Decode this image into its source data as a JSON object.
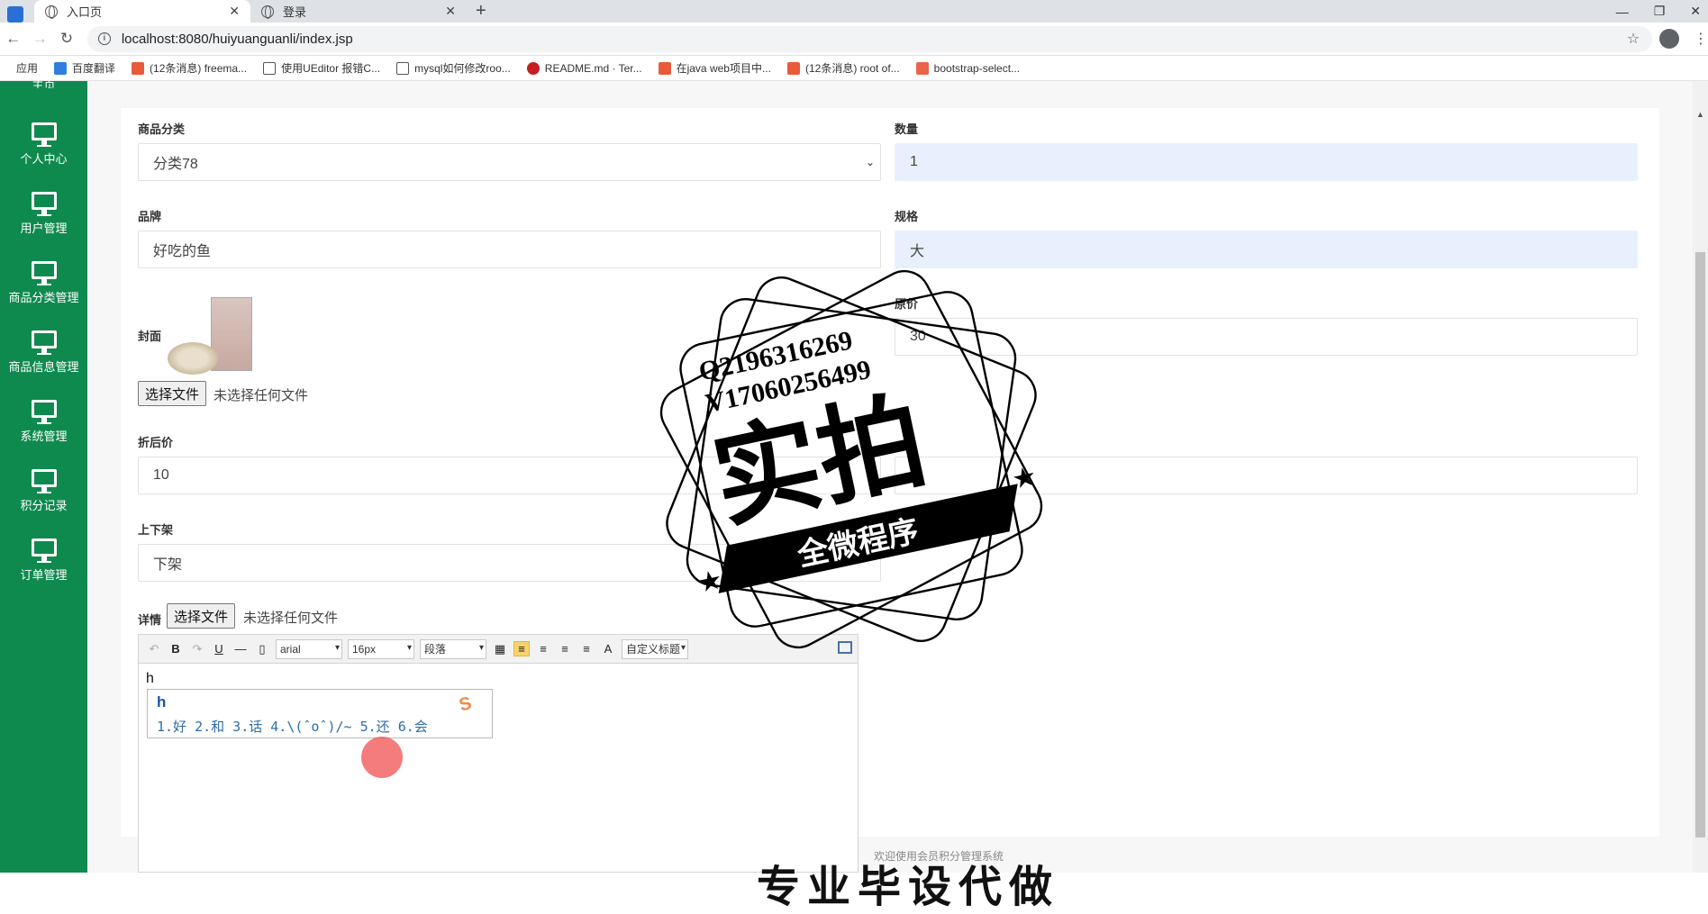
{
  "browser": {
    "tabs": [
      {
        "label": "入口页",
        "active": true
      },
      {
        "label": "登录",
        "active": false
      }
    ],
    "url": "localhost:8080/huiyuanguanli/index.jsp",
    "bookmarks": [
      "应用",
      "百度翻译",
      "(12条消息) freema...",
      "使用UEditor 报错C...",
      "mysql如何修改roo...",
      "README.md · Ter...",
      "在java web项目中...",
      "(12条消息) root of...",
      "bootstrap-select..."
    ]
  },
  "sidebar": {
    "top_partial": "主页",
    "items": [
      {
        "label": "个人中心",
        "icon": "monitor-icon"
      },
      {
        "label": "用户管理",
        "icon": "monitor-icon"
      },
      {
        "label": "商品分类管理",
        "icon": "monitor-icon"
      },
      {
        "label": "商品信息管理",
        "icon": "monitor-icon"
      },
      {
        "label": "系统管理",
        "icon": "monitor-icon"
      },
      {
        "label": "积分记录",
        "icon": "monitor-icon"
      },
      {
        "label": "订单管理",
        "icon": "monitor-icon"
      }
    ],
    "bg_color": "#0f8a4f"
  },
  "form": {
    "category": {
      "label": "商品分类",
      "value": "分类78"
    },
    "quantity": {
      "label": "数量",
      "value": "1"
    },
    "brand": {
      "label": "品牌",
      "value": "好吃的鱼"
    },
    "spec": {
      "label": "规格",
      "value": "大"
    },
    "cover": {
      "label": "封面",
      "button": "选择文件",
      "status": "未选择任何文件"
    },
    "original_price": {
      "label": "原价",
      "value": "30"
    },
    "discount_price": {
      "label": "折后价",
      "value": "10"
    },
    "right_field_value": "1",
    "shelf": {
      "label": "上下架",
      "value": "下架"
    },
    "detail": {
      "label": "详情",
      "button": "选择文件",
      "status": "未选择任何文件"
    }
  },
  "editor": {
    "font": "arial",
    "size": "16px",
    "paragraph": "段落",
    "custom_title": "自定义标题",
    "content": "h"
  },
  "ime": {
    "input": "h",
    "candidates": "1.好 2.和 3.话 4.\\(ˆoˆ)/~ 5.还 6.会"
  },
  "watermark": {
    "line1": "Q2196316269",
    "line2": "V17060256499",
    "big": "实拍",
    "banner": "全微程序"
  },
  "footer": {
    "text": "欢迎使用会员积分管理系统",
    "big_partial": "专业毕设代做"
  }
}
